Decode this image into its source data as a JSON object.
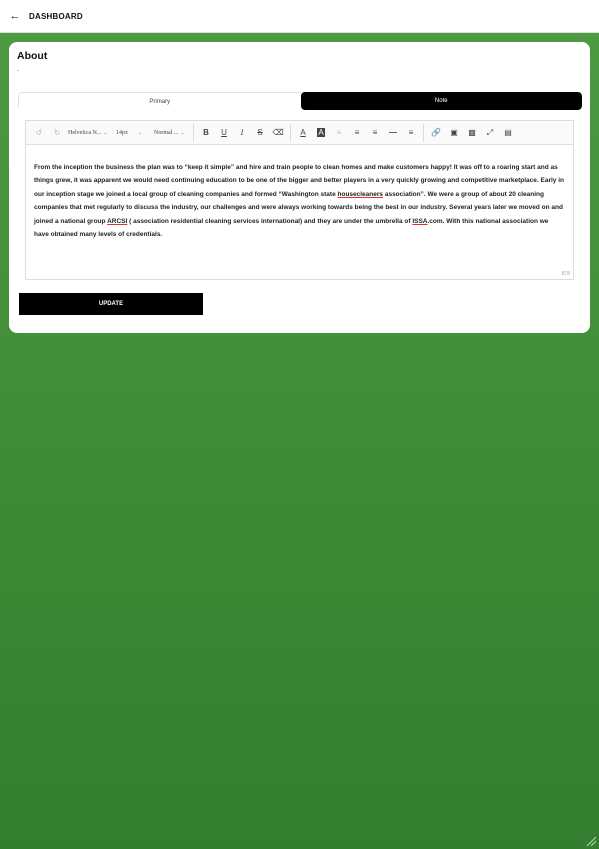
{
  "header": {
    "back_icon": "arrow-left-icon",
    "title": "DASHBOARD"
  },
  "card": {
    "title": "About",
    "subtitle": "-"
  },
  "tabs": [
    {
      "label": "Primary",
      "active": false
    },
    {
      "label": "Note",
      "active": true
    }
  ],
  "editor": {
    "font_family": "Helvetica N...",
    "font_size": "14px",
    "paragraph_style": "Normal ...",
    "content": {
      "p1": "From the inception the business the plan was to “keep it simple” and hire and train people to clean homes and make customers happy! It was off to a roaring start and as things grew, it was apparent we would need continuing education to be one of the bigger and better players in a very quickly growing and competitive marketplace. Early in our inception stage we joined a local group of cleaning companies and formed “Washington state ",
      "w1": "housecleaners",
      "p2": " association”. We were a group of about 20 cleaning companies that met regularly to discuss the industry, our challenges and were always working towards being the best in our industry. Several years later we moved on and joined a national group ",
      "w2": "ARCSI",
      "p3": " ( association residential cleaning services international) and they are under the umbrella of ",
      "w3": "ISSA",
      "p4": ".com. With this national association we have obtained many levels of credentials."
    },
    "char_count": "878"
  },
  "update_button": "UPDATE",
  "colors": {
    "background": "#4f9b44",
    "active_tab": "#000000",
    "button": "#000000"
  }
}
